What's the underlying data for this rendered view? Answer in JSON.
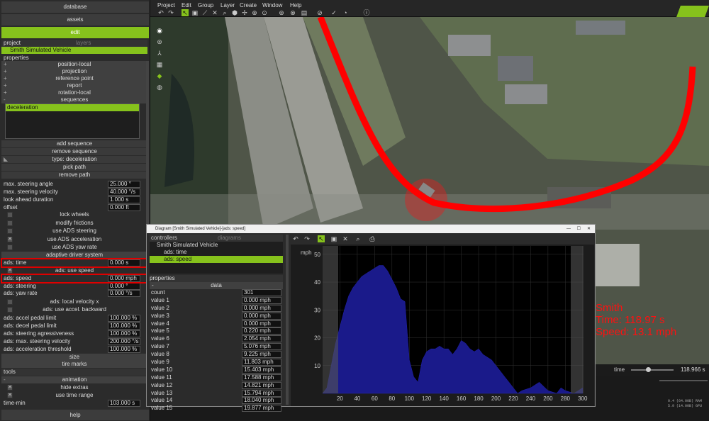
{
  "left": {
    "database": "database",
    "assets": "assets",
    "edit": "edit",
    "tabs": {
      "project": "project",
      "layers": "layers"
    },
    "vehicle": "Smith Simulated Vehicle",
    "properties": "properties",
    "groups": [
      "position-local",
      "projection",
      "reference point",
      "report",
      "rotation-local",
      "sequences"
    ],
    "sequence_item": "deceleration",
    "seq_buttons": [
      "add sequence",
      "remove sequence",
      "type: deceleration",
      "pick path",
      "remove path"
    ],
    "params1": [
      {
        "label": "max. steering angle",
        "value": "25.000 °"
      },
      {
        "label": "max. steering velocity",
        "value": "40.000 °/s"
      },
      {
        "label": "look ahead duration",
        "value": "1.000 s"
      },
      {
        "label": "offset",
        "value": "0.000 ft"
      }
    ],
    "checks": [
      {
        "label": "lock wheels",
        "checked": false
      },
      {
        "label": "modify frictions",
        "checked": false
      },
      {
        "label": "use ADS steering",
        "checked": false
      },
      {
        "label": "use ADS acceleration",
        "checked": true
      },
      {
        "label": "use ADS yaw rate",
        "checked": false
      }
    ],
    "adaptive": "adaptive driver system",
    "ads_time": {
      "label": "ads: time",
      "value": "0.000 s"
    },
    "use_speed": "ads: use speed",
    "ads_speed": {
      "label": "ads: speed",
      "value": "0.000 mph"
    },
    "ads_steering": {
      "label": "ads: steering",
      "value": "0.000 °"
    },
    "ads_yaw": {
      "label": "ads: yaw rate",
      "value": "0.000 °/s"
    },
    "checks2": [
      {
        "label": "ads: local velocity x",
        "checked": false
      },
      {
        "label": "ads: use accel. backward",
        "checked": false
      }
    ],
    "params2": [
      {
        "label": "ads: accel pedal limit",
        "value": "100.000 %"
      },
      {
        "label": "ads: decel pedal limit",
        "value": "100.000 %"
      },
      {
        "label": "ads: steering agressiveness",
        "value": "100.000 %"
      },
      {
        "label": "ads: max. steering velocity",
        "value": "200.000 °/s"
      },
      {
        "label": "ads: acceleration threshold",
        "value": "100.000 %"
      }
    ],
    "size": "size",
    "tire_marks": "tire marks",
    "tools": "tools",
    "animation": "animation",
    "hide_extras": "hide extras",
    "use_time_range": "use time range",
    "time_min": {
      "label": "time-min",
      "value": "103.000 s"
    },
    "help": "help"
  },
  "menu": [
    "Project",
    "Edit",
    "Group",
    "Layer",
    "Create",
    "Window",
    "Help"
  ],
  "map_overlay": {
    "name": "Smith",
    "time": "Time: 118.97 s",
    "speed": "Speed: 13.1 mph"
  },
  "timeline": {
    "label": "time",
    "value": "118.966 s"
  },
  "status": {
    "line1": "0.4 (64.00B) RAM",
    "line2": "5.9 (14.00B) GPU"
  },
  "diagram": {
    "title": "Diagram [Smith Simulated Vehicle]-[ads: speed]",
    "tabs": {
      "controllers": "controllers",
      "diagrams": "diagrams"
    },
    "tree_root": "Smith Simulated Vehicle",
    "tree_items": [
      "ads: time",
      "ads: speed"
    ],
    "properties": "properties",
    "data": "data",
    "rows": [
      {
        "label": "count",
        "value": "301"
      },
      {
        "label": "value 1",
        "value": "0.000 mph"
      },
      {
        "label": "value 2",
        "value": "0.000 mph"
      },
      {
        "label": "value 3",
        "value": "0.000 mph"
      },
      {
        "label": "value 4",
        "value": "0.000 mph"
      },
      {
        "label": "value 5",
        "value": "0.220 mph"
      },
      {
        "label": "value 6",
        "value": "2.054 mph"
      },
      {
        "label": "value 7",
        "value": "5.076 mph"
      },
      {
        "label": "value 8",
        "value": "9.225 mph"
      },
      {
        "label": "value 9",
        "value": "11.803 mph"
      },
      {
        "label": "value 10",
        "value": "15.403 mph"
      },
      {
        "label": "value 11",
        "value": "17.588 mph"
      },
      {
        "label": "value 12",
        "value": "14.821 mph"
      },
      {
        "label": "value 13",
        "value": "15.794 mph"
      },
      {
        "label": "value 14",
        "value": "18.040 mph"
      },
      {
        "label": "value 15",
        "value": "19.877 mph"
      }
    ],
    "unit": "mph",
    "yticks": [
      "50",
      "40",
      "30",
      "20",
      "10"
    ],
    "xticks": [
      "20",
      "40",
      "60",
      "80",
      "100",
      "120",
      "140",
      "160",
      "180",
      "200",
      "220",
      "240",
      "260",
      "280",
      "300"
    ]
  },
  "chart_data": {
    "type": "area",
    "xlabel": "",
    "ylabel": "mph",
    "xlim": [
      0,
      301
    ],
    "ylim": [
      0,
      53
    ],
    "x": [
      0,
      5,
      10,
      15,
      20,
      25,
      30,
      35,
      40,
      45,
      50,
      55,
      60,
      65,
      70,
      75,
      80,
      85,
      90,
      95,
      100,
      105,
      110,
      115,
      120,
      125,
      130,
      135,
      140,
      145,
      150,
      155,
      160,
      165,
      170,
      175,
      180,
      185,
      190,
      195,
      200,
      205,
      210,
      215,
      220,
      225,
      230,
      240,
      250,
      260,
      270,
      275,
      280,
      290,
      300
    ],
    "values": [
      0,
      2,
      10,
      18,
      24,
      30,
      35,
      38,
      40,
      42,
      43,
      44,
      45,
      46,
      46,
      44,
      41,
      38,
      34,
      33,
      12,
      6,
      4,
      12,
      15,
      16,
      16,
      17,
      16,
      16,
      14,
      16,
      19,
      18,
      16,
      15,
      16,
      14,
      13,
      12,
      10,
      8,
      6,
      4,
      2,
      0,
      1,
      2,
      4,
      1,
      0,
      2,
      1,
      0,
      2
    ]
  }
}
